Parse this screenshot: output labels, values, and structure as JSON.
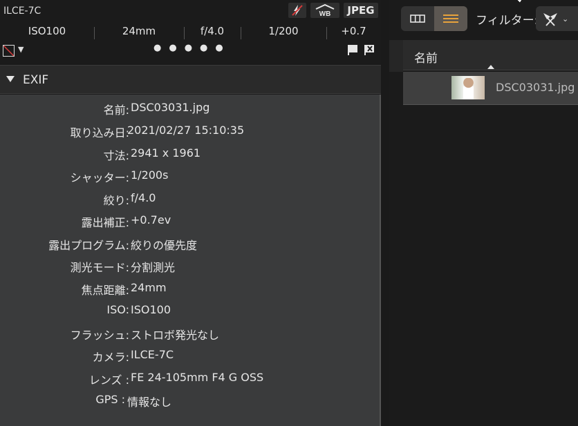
{
  "left_panel": {
    "camera_model": "ILCE-7C",
    "badges": {
      "flash_icon": "flash-off-icon",
      "wb_icon": "white-balance-icon",
      "format": "JPEG"
    },
    "specs": [
      "ISO100",
      "24mm",
      "f/4.0",
      "1/200",
      "+0.7"
    ],
    "rating": {
      "color_label_icon": "color-label-none-icon",
      "dropdown": "▼",
      "stars": [
        "●",
        "●",
        "●",
        "●",
        "●"
      ],
      "flag_icon": "pick-flag-icon",
      "reject_icon": "reject-flag-icon"
    },
    "exif": {
      "title": "EXIF",
      "rows": [
        {
          "label": "名前:",
          "value": "DSC03031.jpg"
        },
        {
          "label": "取り込み日:",
          "value": "2021/02/27 15:10:35"
        },
        {
          "label": "寸法:",
          "value": "2941 x 1961"
        },
        {
          "label": "シャッター:",
          "value": "1/200s"
        },
        {
          "label": "絞り:",
          "value": "f/4.0"
        },
        {
          "label": "露出補正:",
          "value": "+0.7ev"
        },
        {
          "label": "露出プログラム:",
          "value": "絞りの優先度"
        },
        {
          "label": "測光モード:",
          "value": "分割測光"
        },
        {
          "label": "焦点距離:",
          "value": "24mm"
        },
        {
          "label": "ISO:",
          "value": "ISO100"
        },
        {
          "label": "フラッシュ:",
          "value": "ストロボ発光なし"
        },
        {
          "label": "カメラ:",
          "value": "ILCE-7C"
        },
        {
          "label": "レンズ :",
          "value": "FE 24-105mm F4 G OSS"
        },
        {
          "label": "GPS :",
          "value": "情報なし"
        }
      ]
    }
  },
  "right_panel": {
    "view_toggle": {
      "grid_icon": "grid-view-icon",
      "list_icon": "list-view-icon",
      "active": "list"
    },
    "filter_label": "フィルター:",
    "filter_icon": "filter-flags-icon",
    "filter_caret": "⌄",
    "list": {
      "column_header": "名前",
      "files": [
        {
          "name": "DSC03031.jpg"
        }
      ]
    }
  },
  "colors": {
    "accent": "#e8a33c",
    "panel_bg": "#3a3b3c",
    "flag_red": "#d23a3a"
  }
}
